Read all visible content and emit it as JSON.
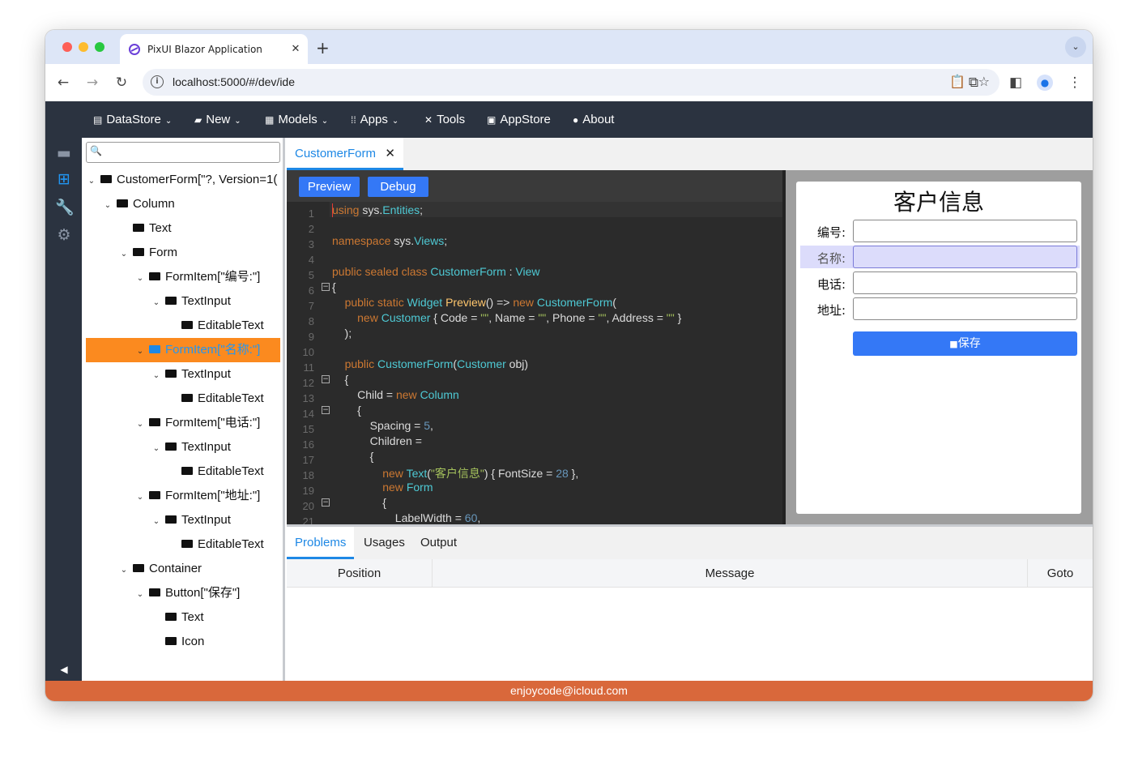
{
  "browser": {
    "tab_title": "PixUI Blazor Application",
    "url": "localhost:5000/#/dev/ide"
  },
  "menu": [
    {
      "label": "DataStore",
      "icon": "database-icon"
    },
    {
      "label": "New",
      "icon": "folder-plus-icon"
    },
    {
      "label": "Models",
      "icon": "grid-icon"
    },
    {
      "label": "Apps",
      "icon": "apps-icon"
    },
    {
      "label": "Tools",
      "icon": "tools-icon"
    },
    {
      "label": "AppStore",
      "icon": "store-icon"
    },
    {
      "label": "About",
      "icon": "help-circle-icon"
    }
  ],
  "tree": {
    "search_placeholder": "",
    "nodes": [
      {
        "label": "CustomerForm[\"?, Version=1(",
        "depth": 0,
        "expanded": true
      },
      {
        "label": "Column",
        "depth": 1,
        "expanded": true
      },
      {
        "label": "Text",
        "depth": 2,
        "expanded": null
      },
      {
        "label": "Form",
        "depth": 2,
        "expanded": true
      },
      {
        "label": "FormItem[\"编号:\"]",
        "depth": 3,
        "expanded": true
      },
      {
        "label": "TextInput",
        "depth": 4,
        "expanded": true
      },
      {
        "label": "EditableText",
        "depth": 5,
        "expanded": null
      },
      {
        "label": "FormItem[\"名称:\"]",
        "depth": 3,
        "expanded": true,
        "selected": true
      },
      {
        "label": "TextInput",
        "depth": 4,
        "expanded": true
      },
      {
        "label": "EditableText",
        "depth": 5,
        "expanded": null
      },
      {
        "label": "FormItem[\"电话:\"]",
        "depth": 3,
        "expanded": true
      },
      {
        "label": "TextInput",
        "depth": 4,
        "expanded": true
      },
      {
        "label": "EditableText",
        "depth": 5,
        "expanded": null
      },
      {
        "label": "FormItem[\"地址:\"]",
        "depth": 3,
        "expanded": true
      },
      {
        "label": "TextInput",
        "depth": 4,
        "expanded": true
      },
      {
        "label": "EditableText",
        "depth": 5,
        "expanded": null
      },
      {
        "label": "Container",
        "depth": 2,
        "expanded": true
      },
      {
        "label": "Button[\"保存\"]",
        "depth": 3,
        "expanded": true
      },
      {
        "label": "Text",
        "depth": 4,
        "expanded": null
      },
      {
        "label": "Icon",
        "depth": 4,
        "expanded": null
      }
    ]
  },
  "doc_tab": {
    "label": "CustomerForm"
  },
  "editor": {
    "preview_label": "Preview",
    "debug_label": "Debug",
    "line_numbers": [
      "1",
      "2",
      "3",
      "4",
      "5",
      "6",
      "7",
      "8",
      "9",
      "10",
      "11",
      "12",
      "13",
      "14",
      "15",
      "16",
      "17",
      "18",
      "19",
      "20",
      "21"
    ],
    "code_lines": [
      [
        [
          "k",
          "using"
        ],
        [
          "p",
          " sys."
        ],
        [
          "ty",
          "Entities"
        ],
        [
          "p",
          ";"
        ]
      ],
      [],
      [
        [
          "k",
          "namespace"
        ],
        [
          "p",
          " sys."
        ],
        [
          "ty",
          "Views"
        ],
        [
          "p",
          ";"
        ]
      ],
      [],
      [
        [
          "k",
          "public sealed class"
        ],
        [
          "p",
          " "
        ],
        [
          "ty",
          "CustomerForm"
        ],
        [
          "p",
          " : "
        ],
        [
          "ty",
          "View"
        ]
      ],
      [
        [
          "p",
          "{"
        ]
      ],
      [
        [
          "p",
          "    "
        ],
        [
          "k",
          "public static"
        ],
        [
          "p",
          " "
        ],
        [
          "ty",
          "Widget"
        ],
        [
          "p",
          " "
        ],
        [
          "m",
          "Preview"
        ],
        [
          "p",
          "() => "
        ],
        [
          "k",
          "new"
        ],
        [
          "p",
          " "
        ],
        [
          "ty",
          "CustomerForm"
        ],
        [
          "p",
          "("
        ]
      ],
      [
        [
          "p",
          "        "
        ],
        [
          "k",
          "new"
        ],
        [
          "p",
          " "
        ],
        [
          "ty",
          "Customer"
        ],
        [
          "p",
          " { Code = "
        ],
        [
          "s",
          "\"\""
        ],
        [
          "p",
          ", Name = "
        ],
        [
          "s",
          "\"\""
        ],
        [
          "p",
          ", Phone = "
        ],
        [
          "s",
          "\"\""
        ],
        [
          "p",
          ", Address = "
        ],
        [
          "s",
          "\"\""
        ],
        [
          "p",
          " }"
        ]
      ],
      [
        [
          "p",
          "    );"
        ]
      ],
      [],
      [
        [
          "p",
          "    "
        ],
        [
          "k",
          "public"
        ],
        [
          "p",
          " "
        ],
        [
          "ty",
          "CustomerForm"
        ],
        [
          "p",
          "("
        ],
        [
          "ty",
          "Customer"
        ],
        [
          "p",
          " obj)"
        ]
      ],
      [
        [
          "p",
          "    {"
        ]
      ],
      [
        [
          "p",
          "        Child = "
        ],
        [
          "k",
          "new"
        ],
        [
          "p",
          " "
        ],
        [
          "ty",
          "Column"
        ]
      ],
      [
        [
          "p",
          "        {"
        ]
      ],
      [
        [
          "p",
          "            Spacing = "
        ],
        [
          "n",
          "5"
        ],
        [
          "p",
          ","
        ]
      ],
      [
        [
          "p",
          "            Children ="
        ]
      ],
      [
        [
          "p",
          "            {"
        ]
      ],
      [
        [
          "p",
          "                "
        ],
        [
          "k",
          "new"
        ],
        [
          "p",
          " "
        ],
        [
          "ty",
          "Text"
        ],
        [
          "p",
          "("
        ],
        [
          "s",
          "\"客户信息\""
        ],
        [
          "p",
          ") { FontSize = "
        ],
        [
          "n",
          "28"
        ],
        [
          "p",
          " },"
        ]
      ],
      [
        [
          "p",
          "                "
        ],
        [
          "k",
          "new"
        ],
        [
          "p",
          " "
        ],
        [
          "ty",
          "Form"
        ]
      ],
      [
        [
          "p",
          "                {"
        ]
      ],
      [
        [
          "p",
          "                    LabelWidth = "
        ],
        [
          "n",
          "60"
        ],
        [
          "p",
          ","
        ]
      ]
    ]
  },
  "preview": {
    "title": "客户信息",
    "fields": [
      {
        "label": "编号:",
        "value": ""
      },
      {
        "label": "名称:",
        "value": ""
      },
      {
        "label": "电话:",
        "value": ""
      },
      {
        "label": "地址:",
        "value": ""
      }
    ],
    "save_label": "保存"
  },
  "bottom": {
    "tabs": [
      "Problems",
      "Usages",
      "Output"
    ],
    "columns": [
      "Position",
      "Message",
      "Goto"
    ]
  },
  "footer": {
    "text": "enjoycode@icloud.com"
  },
  "colors": {
    "app_bar": "#2b3340",
    "accent": "#1e88e5",
    "selection": "#fb8a1f",
    "button": "#3478f6",
    "footer": "#d9683b"
  }
}
